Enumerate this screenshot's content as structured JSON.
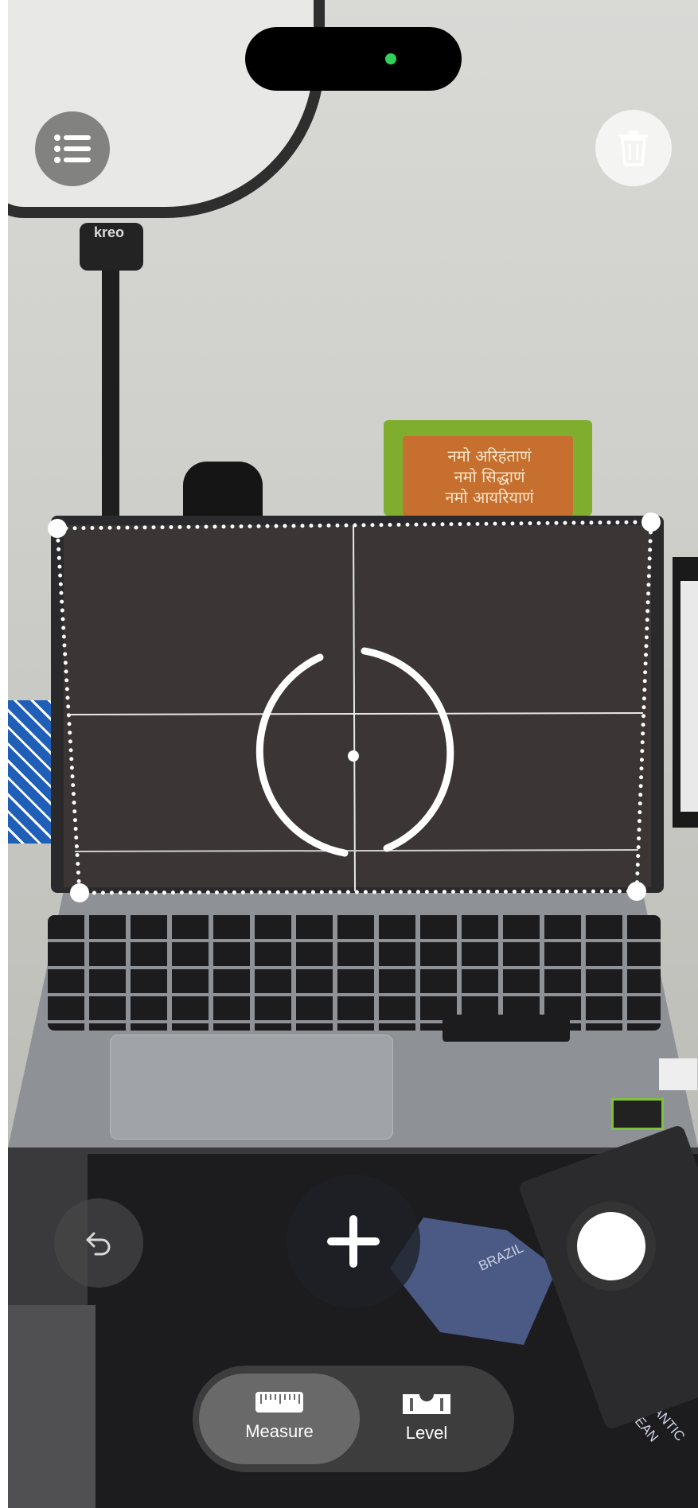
{
  "app": {
    "name": "Measure"
  },
  "scene": {
    "lamp_brand": "kreo",
    "poster_lines": [
      "नमो अरिहंताणं",
      "नमो सिद्धाणं",
      "नमो आयरियाणं"
    ],
    "mat_labels": {
      "brazil": "BRAZIL",
      "atlantic": [
        "ATLANTIC",
        "OCEAN"
      ]
    }
  },
  "toolbar": {
    "list_icon": "list-icon",
    "delete_icon": "trash-icon",
    "undo_icon": "undo-icon",
    "add_icon": "plus-icon",
    "capture_icon": "shutter-icon"
  },
  "modes": [
    {
      "label": "Measure",
      "icon": "ruler-icon",
      "active": true
    },
    {
      "label": "Level",
      "icon": "level-icon",
      "active": false
    }
  ],
  "colors": {
    "island_indicator": "#2fd158",
    "overlay": "#ffffff"
  }
}
